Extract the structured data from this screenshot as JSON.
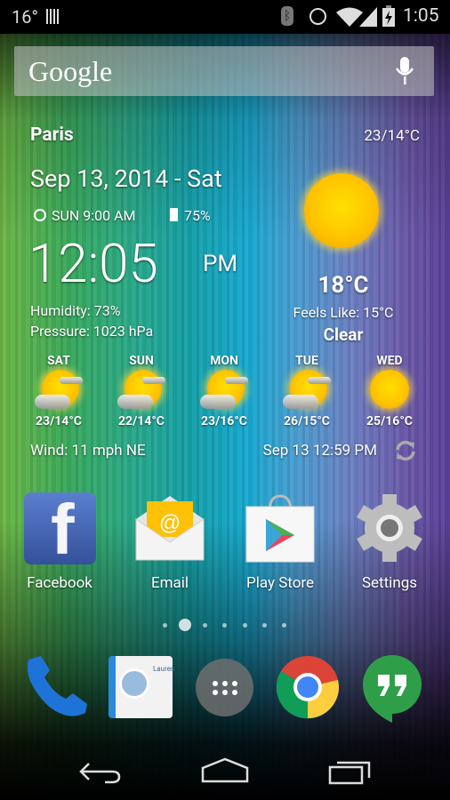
{
  "status_bar": {
    "temperature": "16°",
    "time": "1:05",
    "icons": [
      "barcode-icon",
      "bluetooth-icon",
      "alarm-icon",
      "wifi-icon",
      "signal-icon",
      "battery-charging-icon"
    ]
  },
  "search": {
    "logo": "Google",
    "mic_icon": "mic-icon"
  },
  "weather": {
    "city": "Paris",
    "hi_lo": "23/14°C",
    "date": "Sep 13, 2014 - Sat",
    "alarm": "SUN 9:00 AM",
    "battery": "75%",
    "time": "12:05",
    "ampm": "PM",
    "humidity": "Humidity: 73%",
    "pressure": "Pressure: 1023 hPa",
    "current_temp": "18°C",
    "feels_like": "Feels Like: 15°C",
    "condition": "Clear",
    "forecast": [
      {
        "day": "SAT",
        "temp": "23/14°C",
        "icon": "partly-cloudy-icon"
      },
      {
        "day": "SUN",
        "temp": "22/14°C",
        "icon": "partly-cloudy-icon"
      },
      {
        "day": "MON",
        "temp": "23/16°C",
        "icon": "partly-cloudy-icon"
      },
      {
        "day": "TUE",
        "temp": "26/15°C",
        "icon": "partly-cloudy-icon"
      },
      {
        "day": "WED",
        "temp": "25/16°C",
        "icon": "sunny-icon"
      }
    ],
    "wind": "Wind: 11 mph NE",
    "updated": "Sep 13  12:59 PM"
  },
  "apps": [
    {
      "label": "Facebook"
    },
    {
      "label": "Email"
    },
    {
      "label": "Play Store"
    },
    {
      "label": "Settings"
    }
  ],
  "pages": {
    "count": 7,
    "current": 2
  },
  "dock": [
    {
      "name": "Phone"
    },
    {
      "name": "People"
    },
    {
      "name": "Apps"
    },
    {
      "name": "Chrome"
    },
    {
      "name": "Hangouts"
    }
  ],
  "contact_card_text": "Lauren"
}
